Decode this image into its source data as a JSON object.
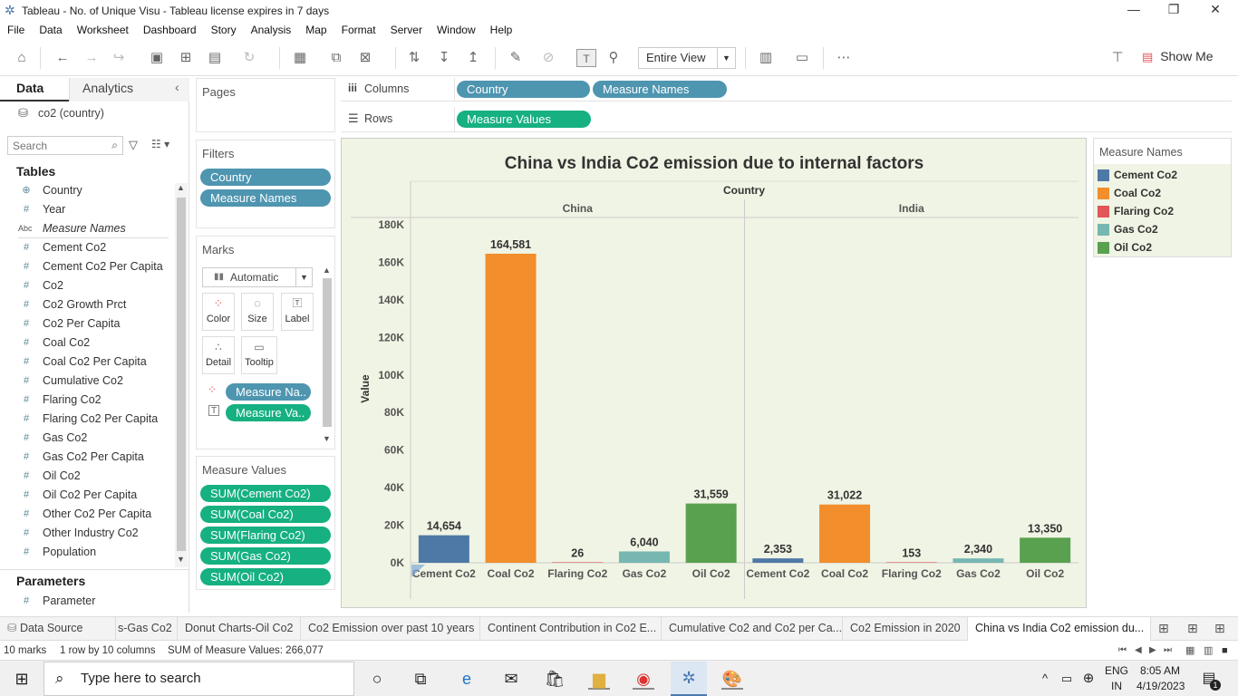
{
  "window": {
    "title": "Tableau - No. of Unique Visu - Tableau license expires in 7 days",
    "minimize": "—",
    "restore": "❐",
    "close": "✕"
  },
  "menu": [
    "File",
    "Data",
    "Worksheet",
    "Dashboard",
    "Story",
    "Analysis",
    "Map",
    "Format",
    "Server",
    "Window",
    "Help"
  ],
  "toolbar": {
    "fit_value": "Entire View",
    "show_me": "Show Me"
  },
  "data_pane": {
    "tab_data": "Data",
    "tab_analytics": "Analytics",
    "datasource": "co2 (country)",
    "search_placeholder": "Search",
    "tables_label": "Tables",
    "fields": [
      {
        "icon": "⊕",
        "name": "Country"
      },
      {
        "icon": "#",
        "name": "Year"
      },
      {
        "icon": "Abc",
        "name": "Measure Names"
      },
      {
        "icon": "#",
        "name": "Cement Co2"
      },
      {
        "icon": "#",
        "name": "Cement Co2 Per Capita"
      },
      {
        "icon": "#",
        "name": "Co2"
      },
      {
        "icon": "#",
        "name": "Co2 Growth Prct"
      },
      {
        "icon": "#",
        "name": "Co2 Per Capita"
      },
      {
        "icon": "#",
        "name": "Coal Co2"
      },
      {
        "icon": "#",
        "name": "Coal Co2 Per Capita"
      },
      {
        "icon": "#",
        "name": "Cumulative Co2"
      },
      {
        "icon": "#",
        "name": "Flaring Co2"
      },
      {
        "icon": "#",
        "name": "Flaring Co2 Per Capita"
      },
      {
        "icon": "#",
        "name": "Gas Co2"
      },
      {
        "icon": "#",
        "name": "Gas Co2 Per Capita"
      },
      {
        "icon": "#",
        "name": "Oil Co2"
      },
      {
        "icon": "#",
        "name": "Oil Co2 Per Capita"
      },
      {
        "icon": "#",
        "name": "Other Co2 Per Capita"
      },
      {
        "icon": "#",
        "name": "Other Industry Co2"
      },
      {
        "icon": "#",
        "name": "Population"
      }
    ],
    "parameters_label": "Parameters",
    "parameters": [
      {
        "icon": "#",
        "name": "Parameter"
      }
    ]
  },
  "cards": {
    "pages": "Pages",
    "filters": "Filters",
    "filter_pills": [
      "Country",
      "Measure Names"
    ],
    "marks": "Marks",
    "mark_type": "Automatic",
    "mark_buttons": [
      "Color",
      "Size",
      "Label",
      "Detail",
      "Tooltip"
    ],
    "mark_pills": [
      "Measure Na..",
      "Measure Va.."
    ],
    "measure_values": "Measure Values",
    "measure_value_pills": [
      "SUM(Cement Co2)",
      "SUM(Coal Co2)",
      "SUM(Flaring Co2)",
      "SUM(Gas Co2)",
      "SUM(Oil Co2)"
    ]
  },
  "shelves": {
    "columns_label": "Columns",
    "columns_pills": [
      "Country",
      "Measure Names"
    ],
    "rows_label": "Rows",
    "rows_pills": [
      "Measure Values"
    ]
  },
  "chart_data": {
    "type": "bar",
    "title": "China vs India Co2 emission due to internal factors",
    "column_header": "Country",
    "ylabel": "Value",
    "ylim": [
      0,
      180000
    ],
    "yticks": [
      0,
      20000,
      40000,
      60000,
      80000,
      100000,
      120000,
      140000,
      160000,
      180000
    ],
    "ytick_labels": [
      "0K",
      "20K",
      "40K",
      "60K",
      "80K",
      "100K",
      "120K",
      "140K",
      "160K",
      "180K"
    ],
    "categories": [
      "Cement Co2",
      "Coal Co2",
      "Flaring Co2",
      "Gas Co2",
      "Oil Co2"
    ],
    "colors": {
      "Cement Co2": "#4e79a7",
      "Coal Co2": "#f28e2b",
      "Flaring Co2": "#e15759",
      "Gas Co2": "#76b7b2",
      "Oil Co2": "#59a14f"
    },
    "panes": [
      {
        "name": "China",
        "values": [
          14654,
          164581,
          26,
          6040,
          31559
        ],
        "labels": [
          "14,654",
          "164,581",
          "26",
          "6,040",
          "31,559"
        ]
      },
      {
        "name": "India",
        "values": [
          2353,
          31022,
          153,
          2340,
          13350
        ],
        "labels": [
          "2,353",
          "31,022",
          "153",
          "2,340",
          "13,350"
        ]
      }
    ]
  },
  "legend": {
    "title": "Measure Names",
    "items": [
      {
        "name": "Cement Co2",
        "color": "#4e79a7"
      },
      {
        "name": "Coal Co2",
        "color": "#f28e2b"
      },
      {
        "name": "Flaring Co2",
        "color": "#e15759"
      },
      {
        "name": "Gas Co2",
        "color": "#76b7b2"
      },
      {
        "name": "Oil Co2",
        "color": "#59a14f"
      }
    ]
  },
  "sheet_tabs": [
    "Data Source",
    "s-Gas Co2",
    "Donut Charts-Oil Co2",
    "Co2 Emission over past 10 years",
    "Continent Contribution in Co2 E...",
    "Cumulative Co2 and Co2 per Ca...",
    "Co2 Emission in 2020",
    "China vs India Co2 emission du..."
  ],
  "status": {
    "marks": "10 marks",
    "dims": "1 row by 10 columns",
    "sum": "SUM of Measure Values: 266,077"
  },
  "taskbar": {
    "search_placeholder": "Type here to search",
    "lang_top": "ENG",
    "lang_bottom": "IN",
    "time": "8:05 AM",
    "date": "4/19/2023",
    "notif_count": "1"
  }
}
